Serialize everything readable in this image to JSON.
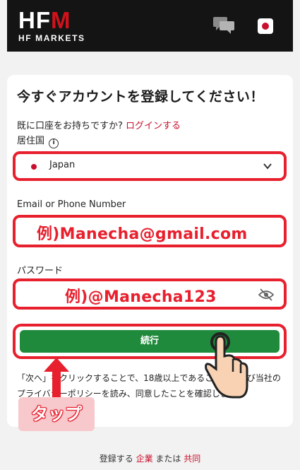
{
  "header": {
    "logo_main": "HFM",
    "logo_sub": "HF MARKETS"
  },
  "form": {
    "title": "今すぐアカウントを登録してください！",
    "login_prompt": "既に口座をお持ちですか?",
    "login_link": "ログインする",
    "residence_label": "居住国",
    "country_value": "Japan",
    "email_label": "Email or Phone Number",
    "email_example": "例)Manecha@gmail.com",
    "password_label": "パスワード",
    "password_example": "例)@Manecha123",
    "continue_label": "続行",
    "terms_text": "「次へ」をクリックすることで、18歳以上であること、および当社のプライバシーポリシーを読み、同意したことを確認します。"
  },
  "annotation": {
    "tap_label": "タップ"
  },
  "footer": {
    "prefix": "登録する",
    "corporate": "企業",
    "middle": "または",
    "joint": "共同"
  },
  "colors": {
    "brand_red": "#c8102e",
    "highlight_red": "#e8202e",
    "continue_green": "#1f8a3b",
    "header_bg": "#141414"
  },
  "icons": [
    "chat-icon",
    "japan-flag-icon",
    "info-icon",
    "chevron-down-icon",
    "eye-slash-icon",
    "hand-pointer-icon",
    "arrow-up-icon"
  ]
}
